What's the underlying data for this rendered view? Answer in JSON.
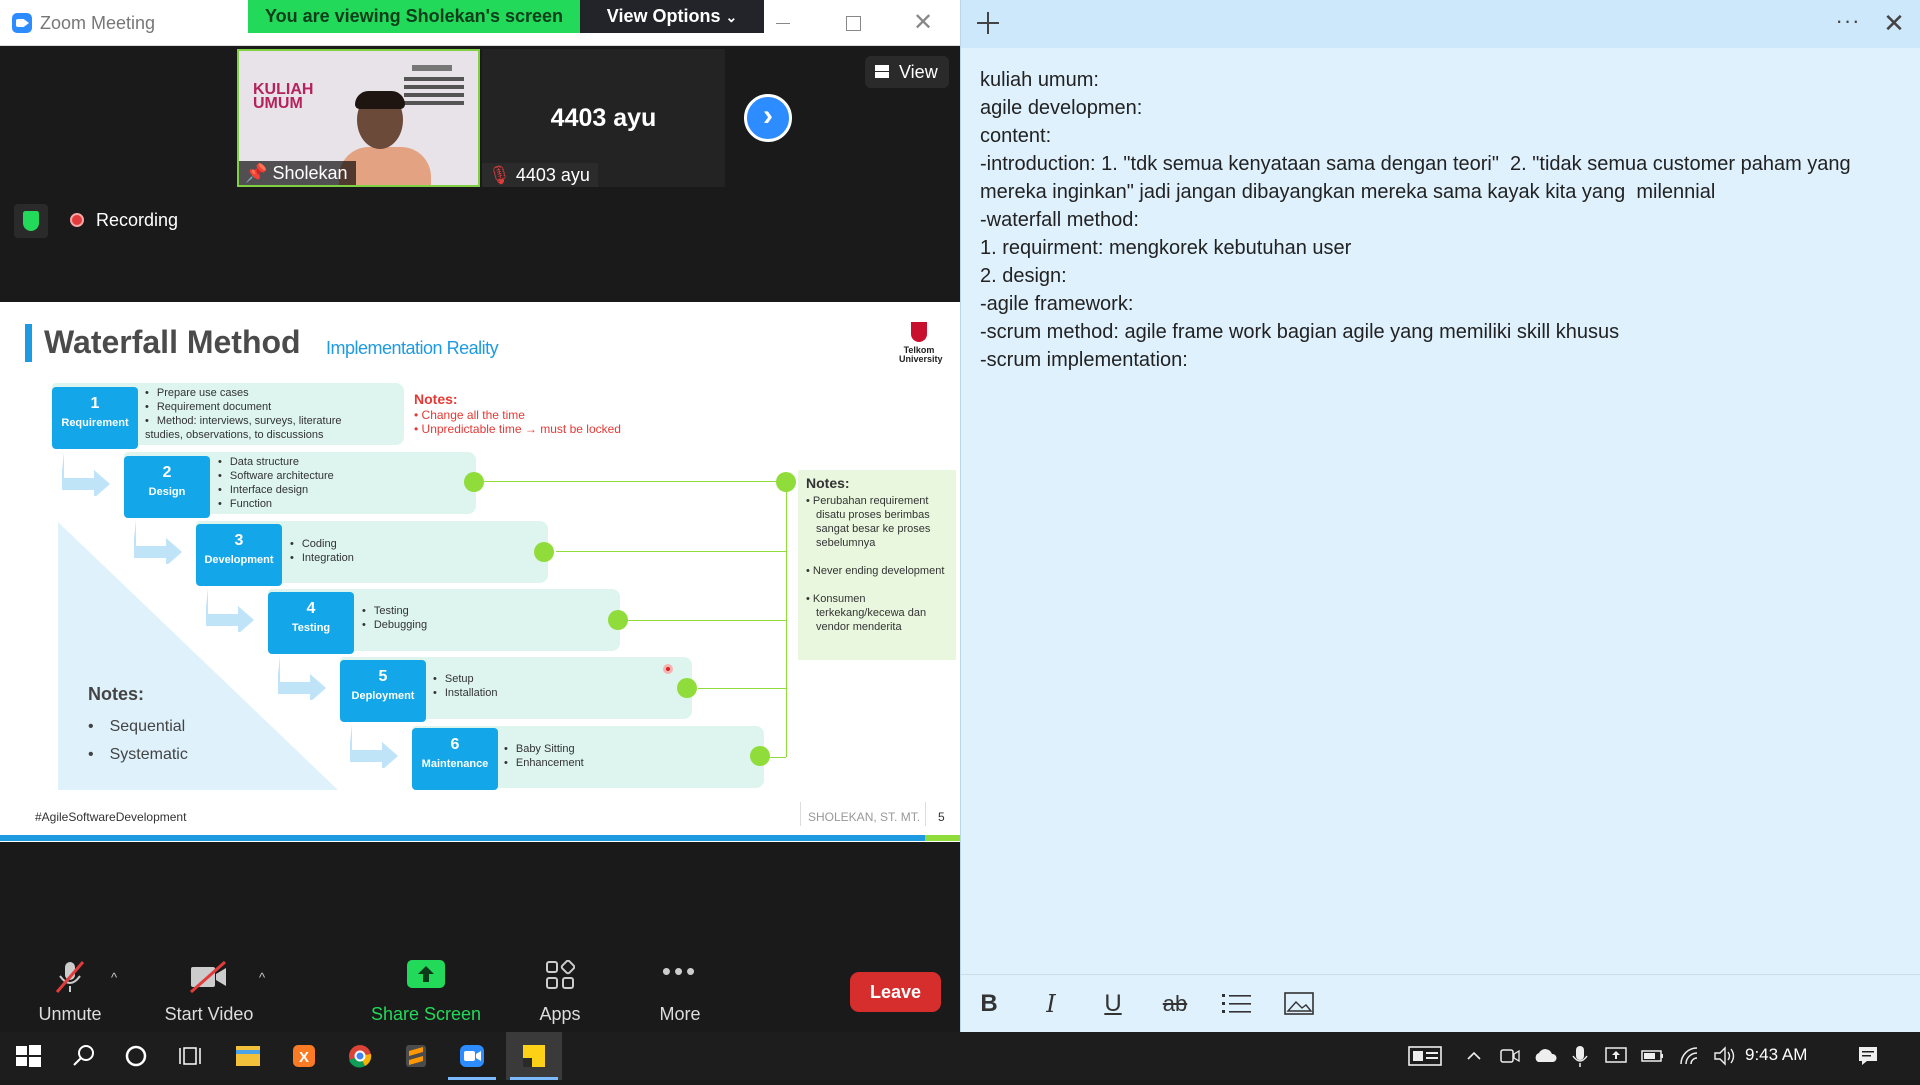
{
  "zoom": {
    "window_title": "Zoom Meeting",
    "viewing_banner": "You are viewing Sholekan's screen",
    "view_options": "View Options",
    "view_options_caret": "⌄",
    "view_button": "View",
    "recording_label": "Recording",
    "next_page_icon": "chevron-right-icon",
    "participants": [
      {
        "name": "Sholekan",
        "thumb_title_line1": "KULIAH",
        "thumb_title_line2": "UMUM",
        "mic": "unmuted"
      },
      {
        "name": "4403 ayu",
        "big_name": "4403 ayu",
        "mic": "muted"
      }
    ],
    "toolbar": {
      "unmute": "Unmute",
      "start_video": "Start Video",
      "share_screen": "Share Screen",
      "apps": "Apps",
      "more": "More",
      "leave": "Leave",
      "caret": "^"
    },
    "colors": {
      "share": "#23d959",
      "leave": "#d62d2d",
      "accent": "#2d8cff"
    }
  },
  "slide": {
    "title": "Waterfall Method",
    "subtitle": "Implementation Reality",
    "logo_text": "Telkom University",
    "steps": [
      {
        "num": "1",
        "label": "Requirement",
        "bullets": [
          "Prepare use cases",
          "Requirement document",
          "Method: interviews, surveys, literature studies, observations, to discussions"
        ]
      },
      {
        "num": "2",
        "label": "Design",
        "bullets": [
          "Data structure",
          "Software architecture",
          "Interface design",
          "Function"
        ]
      },
      {
        "num": "3",
        "label": "Development",
        "bullets": [
          "Coding",
          "Integration"
        ]
      },
      {
        "num": "4",
        "label": "Testing",
        "bullets": [
          "Testing",
          "Debugging"
        ]
      },
      {
        "num": "5",
        "label": "Deployment",
        "bullets": [
          "Setup",
          "Installation"
        ]
      },
      {
        "num": "6",
        "label": "Maintenance",
        "bullets": [
          "Baby Sitting",
          "Enhancement"
        ]
      }
    ],
    "notes_top": {
      "title": "Notes:",
      "items": [
        "• Change all the time",
        "• Unpredictable time → must be locked"
      ]
    },
    "notes_right": {
      "title": "Notes:",
      "items": [
        "• Perubahan requirement disatu proses berimbas sangat besar ke proses sebelumnya",
        "• Never ending development",
        "• Konsumen terkekang/kecewa dan vendor menderita"
      ]
    },
    "notes_left": {
      "title": "Notes:",
      "items": [
        "Sequential",
        "Systematic"
      ]
    },
    "hashtag": "#AgileSoftwareDevelopment",
    "author": "SHOLEKAN, ST. MT.",
    "page": "5"
  },
  "sticky": {
    "lines": [
      "kuliah umum:",
      "agile developmen:",
      "content:",
      "-introduction: 1. \"tdk semua kenyataan sama dengan teori\"  2. \"tidak semua customer paham yang mereka inginkan\" jadi jangan dibayangkan mereka sama kayak kita yang  milennial",
      "-waterfall method:",
      "1. requirment: mengkorek kebutuhan user",
      "2. design:",
      "-agile framework:",
      "-scrum method: agile frame work bagian agile yang memiliki skill khusus",
      "-scrum implementation:"
    ],
    "format": {
      "bold": "B",
      "italic": "I",
      "underline": "U",
      "strike": "ab"
    }
  },
  "taskbar": {
    "clock": "9:43 AM",
    "apps": [
      "start-icon",
      "search-icon",
      "cortana-icon",
      "task-view-icon",
      "file-explorer-icon",
      "xampp-icon",
      "chrome-icon",
      "sublime-text-icon",
      "zoom-icon",
      "sticky-notes-icon"
    ]
  }
}
